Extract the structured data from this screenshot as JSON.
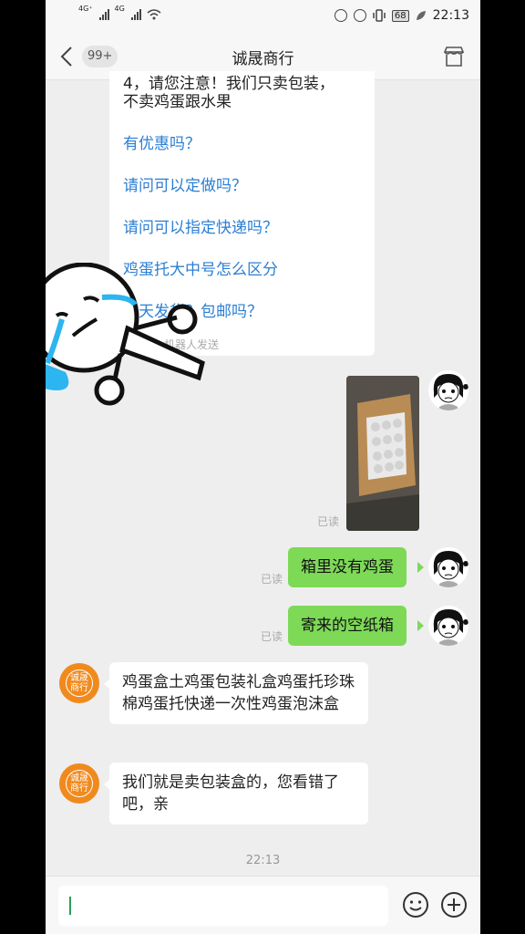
{
  "status_bar": {
    "sim1": "4G⁺",
    "sim2": "4G",
    "battery": "68",
    "time": "22:13"
  },
  "header": {
    "back_label": "",
    "unread_badge": "99+",
    "title": "诚晟商行"
  },
  "messages": {
    "bot_partial_line1": "4，请您注意！我们只卖包装，",
    "bot_partial_line2": "不卖鸡蛋跟水果",
    "quick_questions": [
      "有优惠吗？",
      "请问可以定做吗？",
      "请问可以指定快递吗？",
      "鸡蛋托大中号怎么区分",
      "几天发货？包邮吗？"
    ],
    "bot_note": "机器人发送",
    "image_read": "已读",
    "user_msg1": "箱里没有鸡蛋",
    "user_msg1_read": "已读",
    "user_msg2": "寄来的空纸箱",
    "user_msg2_read": "已读",
    "shop_msg1": "鸡蛋盒土鸡蛋包装礼盒鸡蛋托珍珠棉鸡蛋托快递一次性鸡蛋泡沫盒",
    "shop_msg2": "我们就是卖包装盒的，您看错了吧，亲",
    "timestamp": "22:13",
    "shop_avatar_text": "诚晟商行"
  },
  "colors": {
    "accent_green": "#7ed957",
    "link_blue": "#2b7fd4",
    "shop_orange": "#f08a1e"
  }
}
